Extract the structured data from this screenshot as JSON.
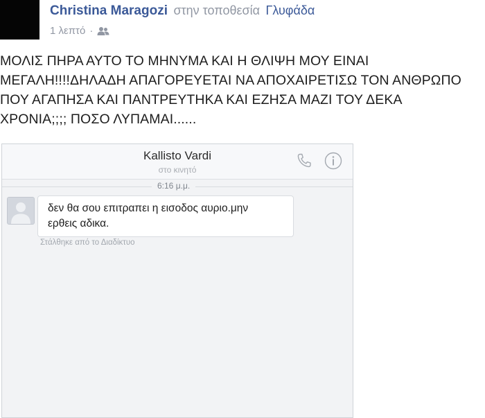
{
  "post": {
    "author": "Christina Maragozi",
    "at_text": "στην τοποθεσία",
    "location": "Γλυφάδα",
    "timestamp": "1 λεπτό",
    "separator": "·",
    "privacy_icon": "friends-icon",
    "text_lines": [
      "ΜΟΛΙΣ ΠΗΡΑ ΑΥΤΟ ΤΟ ΜΗΝΥΜΑ ΚΑΙ Η ΘΛΙΨΗ ΜΟΥ ΕΙΝΑΙ",
      "ΜΕΓΑΛΗ!!!!ΔΗΛΑΔΗ ΑΠΑΓΟΡΕΥΕΤΑΙ ΝΑ ΑΠΟΧΑΙΡΕΤΙΣΩ ΤΟΝ ΑΝΘΡΩΠΟ",
      "ΠΟΥ ΑΓΑΠΗΣΑ ΚΑΙ ΠΑΝΤΡΕΥΤΗΚΑ ΚΑΙ ΕΖΗΣΑ ΜΑΖΙ ΤΟΥ ΔΕΚΑ",
      "ΧΡΟΝΙΑ;;;; ΠΟΣΟ ΛΥΠΑΜΑΙ......"
    ]
  },
  "screenshot": {
    "contact_name": "Kallisto Vardi",
    "contact_status": "στο κινητό",
    "call_icon": "phone-icon",
    "info_icon": "info-icon",
    "time": "6:16 μ.μ.",
    "message_lines": [
      "δεν θα σου επιτραπει η εισοδος αυριο.μην",
      "ερθεις αδικα."
    ],
    "sent_note": "Στάλθηκε από το Διαδίκτυο"
  },
  "colors": {
    "link_blue": "#3b5998",
    "meta_gray": "#9197a3"
  }
}
